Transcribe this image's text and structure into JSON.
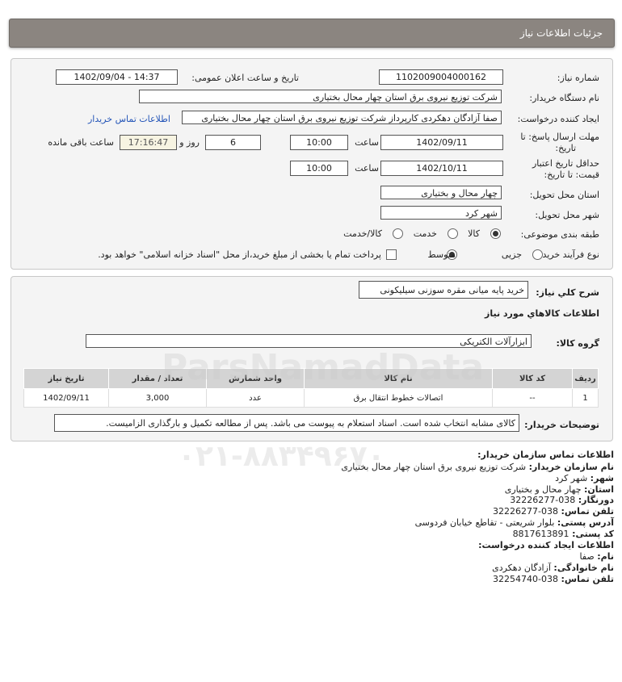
{
  "header": {
    "title": "جزئیات اطلاعات نیاز"
  },
  "form": {
    "need_number_label": "شماره نیاز:",
    "need_number": "1102009004000162",
    "announce_label": "تاریخ و ساعت اعلان عمومی:",
    "announce_value": "1402/09/04 - 14:37",
    "buyer_label": "نام دستگاه خریدار:",
    "buyer_value": "شرکت توزیع نیروی برق استان چهار محال بختیاری",
    "creator_label": "ایجاد کننده درخواست:",
    "creator_value": "صفا آزادگان دهکردی کارپرداز شرکت توزیع نیروی برق استان چهار محال بختیاری",
    "contact_link": "اطلاعات تماس خریدار",
    "deadline_label_1": "مهلت ارسال پاسخ: تا",
    "deadline_label_2": "تاریخ:",
    "deadline_date": "1402/09/11",
    "time_label": "ساعت",
    "deadline_time": "10:00",
    "days_value": "6",
    "days_label": "روز و",
    "remaining_time": "17:16:47",
    "remaining_label": "ساعت باقی مانده",
    "validity_label_1": "حداقل تاریخ اعتبار",
    "validity_label_2": "قیمت: تا تاریخ:",
    "validity_date": "1402/10/11",
    "validity_time": "10:00",
    "province_label": "استان محل تحویل:",
    "province_value": "چهار محال و بختیاری",
    "city_label": "شهر محل تحویل:",
    "city_value": "شهر کرد",
    "category_label": "طبقه بندی موضوعی:",
    "category_options": [
      "کالا",
      "خدمت",
      "کالا/خدمت"
    ],
    "category_selected": "کالا",
    "process_label": "نوع فرآیند خرید :",
    "process_options": [
      "جزیی",
      "متوسط"
    ],
    "process_selected": "متوسط",
    "payment_note": "پرداخت تمام یا بخشی از مبلغ خرید،از محل \"اسناد خزانه اسلامی\" خواهد بود."
  },
  "summary": {
    "desc_label": "شرح کلي نياز:",
    "desc_value": "خرید پایه میانی مقره سوزنی سیلیکونی",
    "goods_info_title": "اطلاعات کالاهاي مورد نياز",
    "group_label": "گروه کالا:",
    "group_value": "ابزارآلات الکتریکی",
    "table": {
      "headers": [
        "ردیف",
        "کد کالا",
        "نام کالا",
        "واحد شمارش",
        "تعداد / مقدار",
        "تاریخ نیاز"
      ],
      "rows": [
        [
          "1",
          "--",
          "اتصالات خطوط انتقال برق",
          "عدد",
          "3,000",
          "1402/09/11"
        ]
      ]
    },
    "notes_label": "توضیحات خریدار:",
    "notes_value": "کالای مشابه انتخاب شده است. اسناد استعلام به پیوست می باشد. پس از مطالعه تکمیل و بارگذاری الزامیست."
  },
  "contact": {
    "title": "اطلاعات تماس سازمان خریدار:",
    "org_label": "نام سازمان خریدار:",
    "org_value": "شرکت توزیع نیروی برق استان چهار محال بختیاری",
    "city_label": "شهر:",
    "city_value": "شهر کرد",
    "province_label": "استان:",
    "province_value": "چهار محال و بختیاری",
    "fax_label": "دورنگار:",
    "fax_value": "038-32226277",
    "phone_label": "تلفن تماس:",
    "phone_value": "038-32226277",
    "address_label": "آدرس پستی:",
    "address_value": "بلوار شریعتی - تقاطع خیابان فردوسی",
    "postal_label": "کد پستی:",
    "postal_value": "8817613891",
    "creator_title": "اطلاعات ایجاد کننده درخواست:",
    "name_label": "نام:",
    "name_value": "صفا",
    "family_label": "نام خانوادگی:",
    "family_value": "آزادگان دهکردی",
    "creator_phone_label": "تلفن تماس:",
    "creator_phone_value": "038-32254740"
  },
  "watermark": {
    "line1": "ParsNamadData",
    "line2": "۰۲۱-۸۸۳۴۹۶۷۰"
  }
}
